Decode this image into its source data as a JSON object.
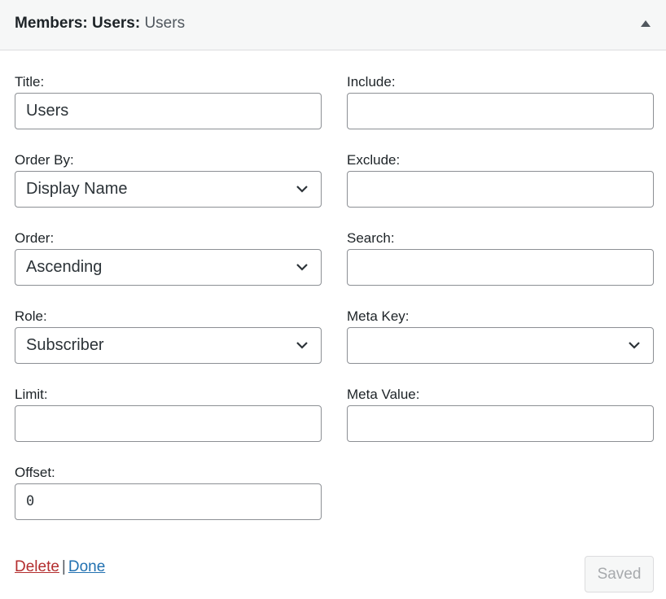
{
  "header": {
    "title": "Members: Users:",
    "subtitle": "Users",
    "toggle_icon": "triangle-up-icon"
  },
  "fields": {
    "title": {
      "label": "Title:",
      "value": "Users"
    },
    "include": {
      "label": "Include:",
      "value": ""
    },
    "order_by": {
      "label": "Order By:",
      "value": "Display Name"
    },
    "exclude": {
      "label": "Exclude:",
      "value": ""
    },
    "order": {
      "label": "Order:",
      "value": "Ascending"
    },
    "search": {
      "label": "Search:",
      "value": ""
    },
    "role": {
      "label": "Role:",
      "value": "Subscriber"
    },
    "meta_key": {
      "label": "Meta Key:",
      "value": ""
    },
    "limit": {
      "label": "Limit:",
      "value": ""
    },
    "meta_value": {
      "label": "Meta Value:",
      "value": ""
    },
    "offset": {
      "label": "Offset:",
      "value": "0"
    }
  },
  "actions": {
    "delete_label": "Delete",
    "separator": "|",
    "done_label": "Done",
    "save_label": "Saved"
  },
  "colors": {
    "delete_link": "#b32d2e",
    "done_link": "#2271b1",
    "header_bg": "#f6f7f7",
    "input_border": "#8c8f94"
  }
}
